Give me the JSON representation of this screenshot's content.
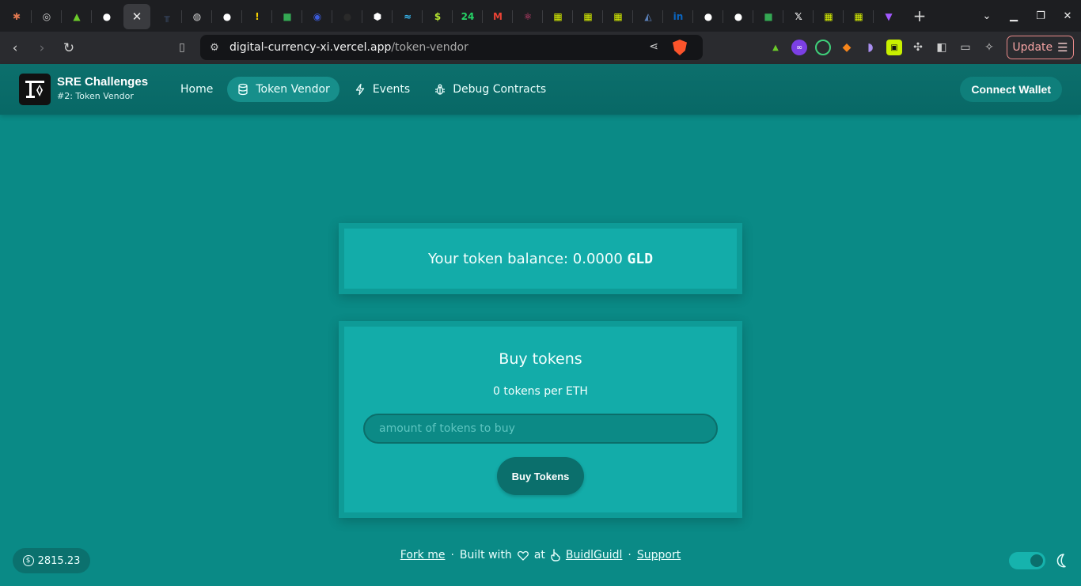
{
  "browser": {
    "tabs": [
      {
        "icon": "claude-icon",
        "color": "#e07850",
        "glyph": "✱"
      },
      {
        "icon": "openai-icon",
        "color": "#d0d0d0",
        "glyph": "◎"
      },
      {
        "icon": "chart-icon",
        "color": "#6bcb2a",
        "glyph": "▲"
      },
      {
        "icon": "github-icon",
        "color": "#ffffff",
        "glyph": "●"
      },
      {
        "icon": "close-icon",
        "color": "#ffffff",
        "glyph": "✕",
        "active": true
      },
      {
        "icon": "scaffold-icon",
        "color": "#3a4a66",
        "glyph": "╥"
      },
      {
        "icon": "globe-icon",
        "color": "#d0d0d0",
        "glyph": "◍"
      },
      {
        "icon": "github-icon",
        "color": "#ffffff",
        "glyph": "●"
      },
      {
        "icon": "warning-icon",
        "color": "#f5d000",
        "glyph": "!"
      },
      {
        "icon": "meet-icon",
        "color": "#34a853",
        "glyph": "■"
      },
      {
        "icon": "app-icon",
        "color": "#3b5bdb",
        "glyph": "◉"
      },
      {
        "icon": "circle-icon",
        "color": "#2a2a2a",
        "glyph": "●"
      },
      {
        "icon": "hex-icon",
        "color": "#ffffff",
        "glyph": "⬢"
      },
      {
        "icon": "tailwind-icon",
        "color": "#38bdf8",
        "glyph": "≈"
      },
      {
        "icon": "dollar-icon",
        "color": "#b7e830",
        "glyph": "$"
      },
      {
        "icon": "whatsapp-icon",
        "color": "#25d366",
        "glyph": "24"
      },
      {
        "icon": "gmail-icon",
        "color": "#ea4335",
        "glyph": "M"
      },
      {
        "icon": "react-icon",
        "color": "#e0457b",
        "glyph": "⚛"
      },
      {
        "icon": "grid-icon",
        "color": "#d8f000",
        "glyph": "▦"
      },
      {
        "icon": "grid-icon",
        "color": "#d8f000",
        "glyph": "▦"
      },
      {
        "icon": "grid-icon",
        "color": "#d8f000",
        "glyph": "▦"
      },
      {
        "icon": "app-icon",
        "color": "#5a7fb8",
        "glyph": "◭"
      },
      {
        "icon": "linkedin-icon",
        "color": "#0a66c2",
        "glyph": "in"
      },
      {
        "icon": "github-icon",
        "color": "#ffffff",
        "glyph": "●"
      },
      {
        "icon": "github-icon",
        "color": "#ffffff",
        "glyph": "●"
      },
      {
        "icon": "meet-icon",
        "color": "#34a853",
        "glyph": "■"
      },
      {
        "icon": "x-icon",
        "color": "#ffffff",
        "glyph": "𝕏"
      },
      {
        "icon": "grid-icon",
        "color": "#d8f000",
        "glyph": "▦"
      },
      {
        "icon": "grid-icon",
        "color": "#d8f000",
        "glyph": "▦"
      },
      {
        "icon": "vite-icon",
        "color": "#a259ff",
        "glyph": "▼"
      }
    ],
    "url_domain": "digital-currency-xi.vercel.app",
    "url_path": "/token-vendor",
    "update_label": "Update"
  },
  "app": {
    "brand_title": "SRE Challenges",
    "brand_subtitle": "#2: Token Vendor",
    "nav": [
      {
        "label": "Home",
        "icon": "",
        "active": false
      },
      {
        "label": "Token Vendor",
        "icon": "database-icon",
        "active": true
      },
      {
        "label": "Events",
        "icon": "bolt-icon",
        "active": false
      },
      {
        "label": "Debug Contracts",
        "icon": "bug-icon",
        "active": false
      }
    ],
    "connect_label": "Connect Wallet"
  },
  "balance": {
    "prefix": "Your token balance: 0.0000",
    "symbol": "GLD"
  },
  "buy": {
    "title": "Buy tokens",
    "rate": "0 tokens per ETH",
    "placeholder": "amount of tokens to buy",
    "button_label": "Buy Tokens"
  },
  "footer": {
    "eth_price": "2815.23",
    "fork_label": "Fork me",
    "built_with": "Built with",
    "at": "at",
    "buidl_label": "BuidlGuidl",
    "support_label": "Support",
    "separator": "·"
  },
  "colors": {
    "page_bg": "#0a8a86",
    "card_bg": "#13aca9",
    "button_bg": "#0b6f6c"
  }
}
